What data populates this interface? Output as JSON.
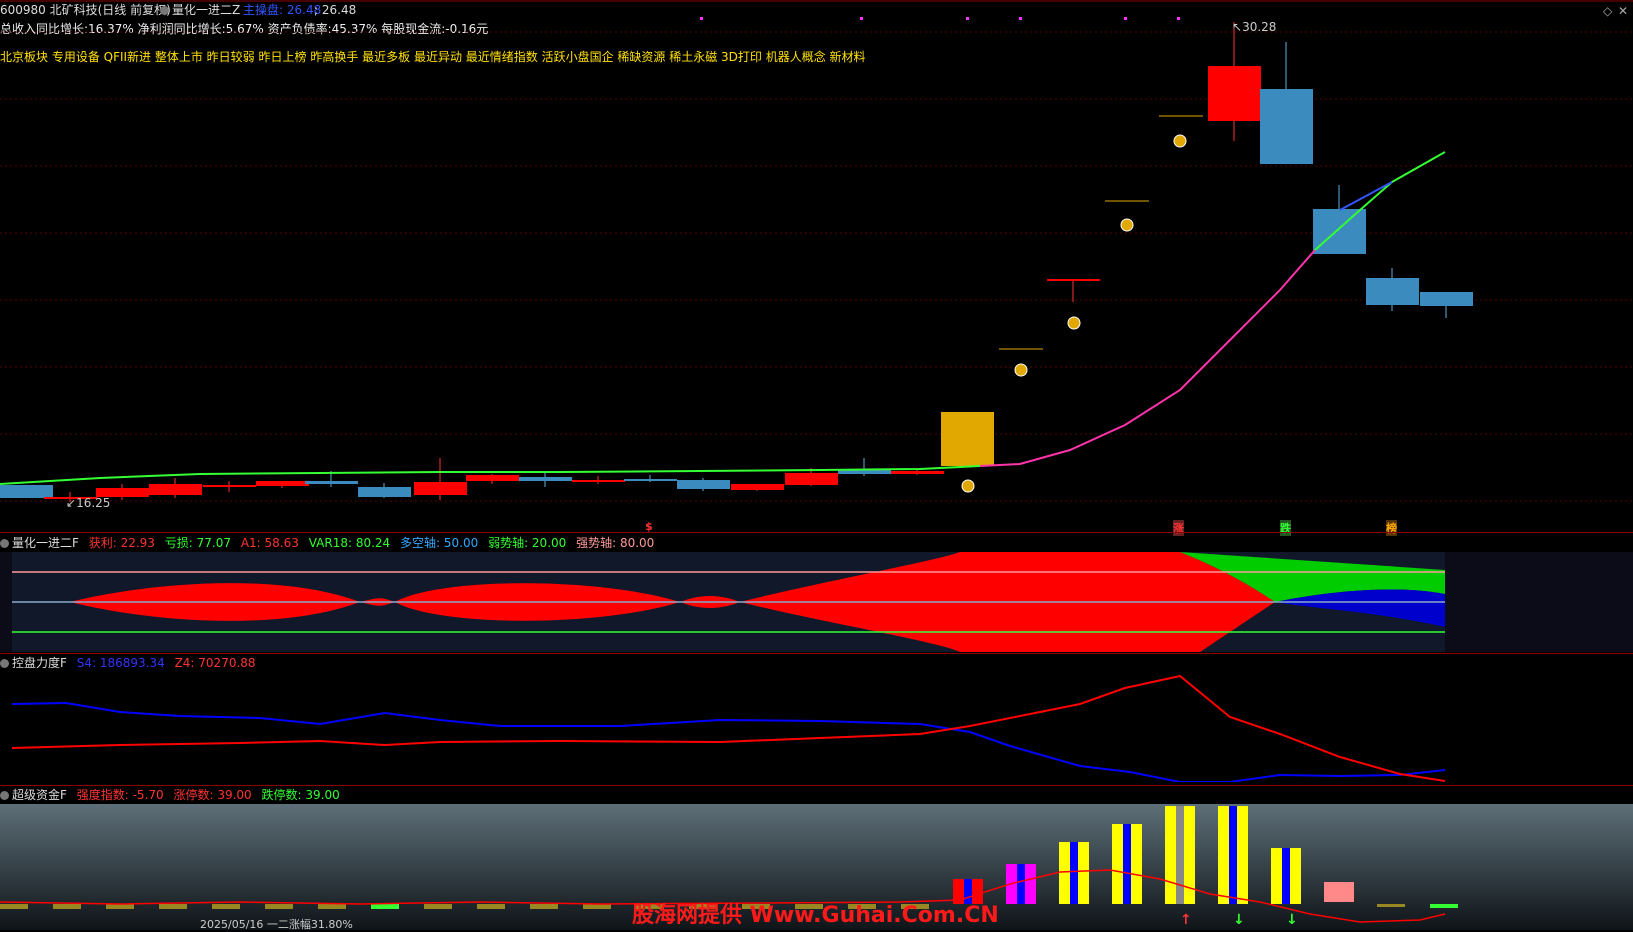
{
  "header": {
    "stock": "600980 北矿科技(日线 前复权)",
    "indicator_name": "量化一进二Z",
    "indicator_label": "主操盘: 26.48",
    "indicator_value": "; 26.48"
  },
  "fundamentals": {
    "line": "总收入同比增长:16.37%  净利润同比增长:5.67%  资产负债率:45.37%  每股现金流:-0.16元"
  },
  "concepts": {
    "line": "北京板块 专用设备 QFII新进 整体上市 昨日较弱 昨日上榜 昨高换手 最近多板 最近异动 最近情绪指数 活跃小盘国企  稀缺资源 稀土永磁 3D打印 机器人概念 新材料"
  },
  "main_chart": {
    "high_label": "30.28",
    "low_label": "16.25",
    "bottom_tags": [
      "$",
      "涨",
      "跌",
      "榜"
    ]
  },
  "panel1": {
    "name": "量化一进二F",
    "items": [
      {
        "label": "获利: 22.93",
        "color": "#ff3333"
      },
      {
        "label": "亏损: 77.07",
        "color": "#33ff33"
      },
      {
        "label": "A1: 58.63",
        "color": "#ff3333"
      },
      {
        "label": "VAR18: 80.24",
        "color": "#33ff33"
      },
      {
        "label": "多空轴: 50.00",
        "color": "#33aaff"
      },
      {
        "label": "弱势轴: 20.00",
        "color": "#33ff33"
      },
      {
        "label": "强势轴: 80.00",
        "color": "#ff9999"
      }
    ]
  },
  "panel2": {
    "name": "控盘力度F",
    "items": [
      {
        "label": "S4: 186893.34",
        "color": "#3333ff"
      },
      {
        "label": "Z4: 70270.88",
        "color": "#ff3333"
      }
    ]
  },
  "panel3": {
    "name": "超级资金F",
    "items": [
      {
        "label": "强度指数: -5.70",
        "color": "#ff3333"
      },
      {
        "label": "涨停数: 39.00",
        "color": "#ff3333"
      },
      {
        "label": "跌停数: 39.00",
        "color": "#33ff33"
      }
    ]
  },
  "watermark": "股海网提供 Www.Guhai.Com.CN",
  "footer_text": "2025/05/16   一二涨幅31.80%",
  "colors": {
    "up": "#ff0000",
    "down": "#3b8bbf",
    "ma": "#33ff33",
    "pink": "#ff33aa",
    "accent": "#ffd700"
  }
}
